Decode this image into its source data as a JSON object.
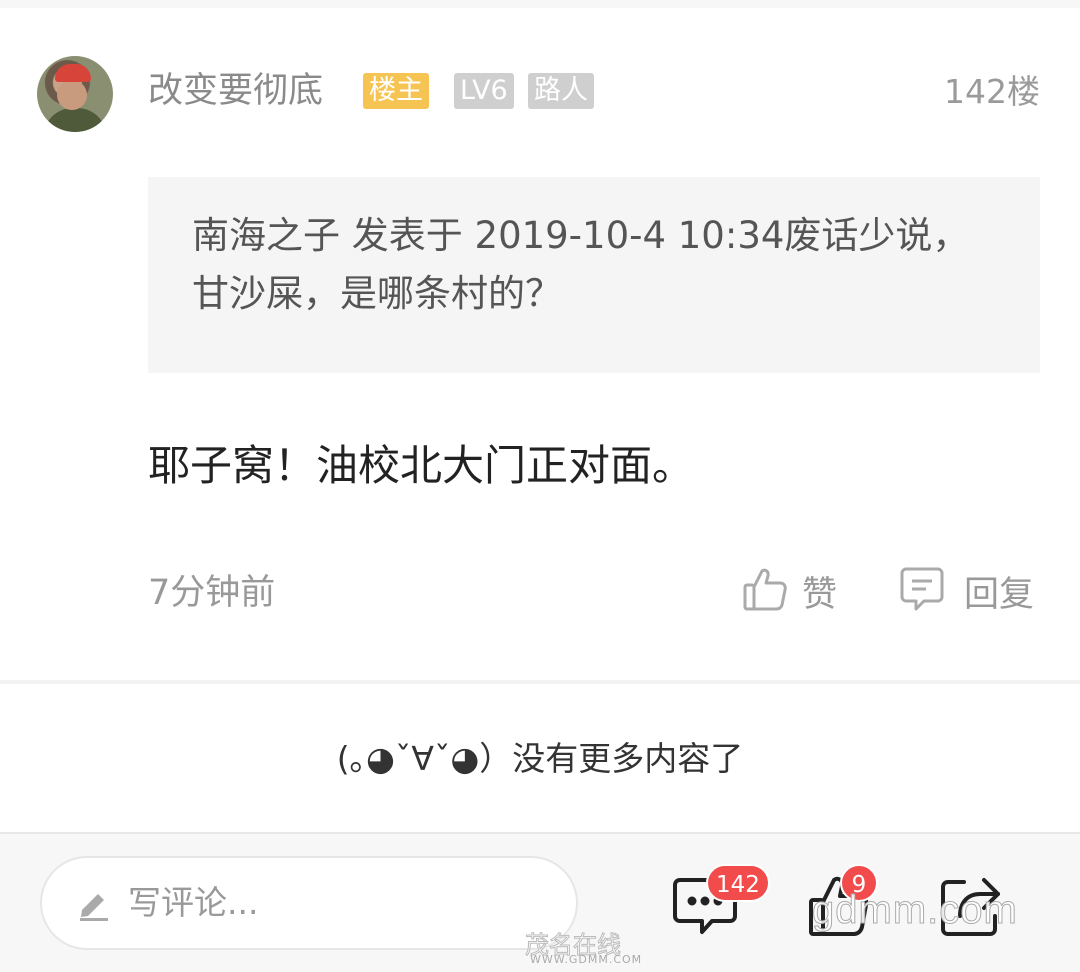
{
  "post": {
    "username": "改变要彻底",
    "badges": {
      "host": "楼主",
      "level": "LV6",
      "role": "路人"
    },
    "floor": "142楼",
    "quote": "南海之子 发表于 2019-10-4 10:34废话少说，甘沙屎，是哪条村的？",
    "content": "耶子窝！油校北大门正对面。",
    "time": "7分钟前",
    "like_label": "赞",
    "reply_label": "回复"
  },
  "footer": {
    "no_more": "(｡◕ˇ∀ˇ◕）没有更多内容了"
  },
  "bottom_bar": {
    "comment_placeholder": "写评论...",
    "comment_count": "142",
    "like_count": "9"
  },
  "watermark": {
    "text": "gdmm.com",
    "cn": "茂名在线",
    "url": "WWW.GDMM.COM"
  },
  "colors": {
    "host_badge": "#f6c453",
    "level_badge": "#cfcfcf",
    "count_bubble": "#f24b4b"
  },
  "icons": [
    "pen-icon",
    "thumbs-up-icon",
    "comment-icon",
    "share-icon"
  ]
}
